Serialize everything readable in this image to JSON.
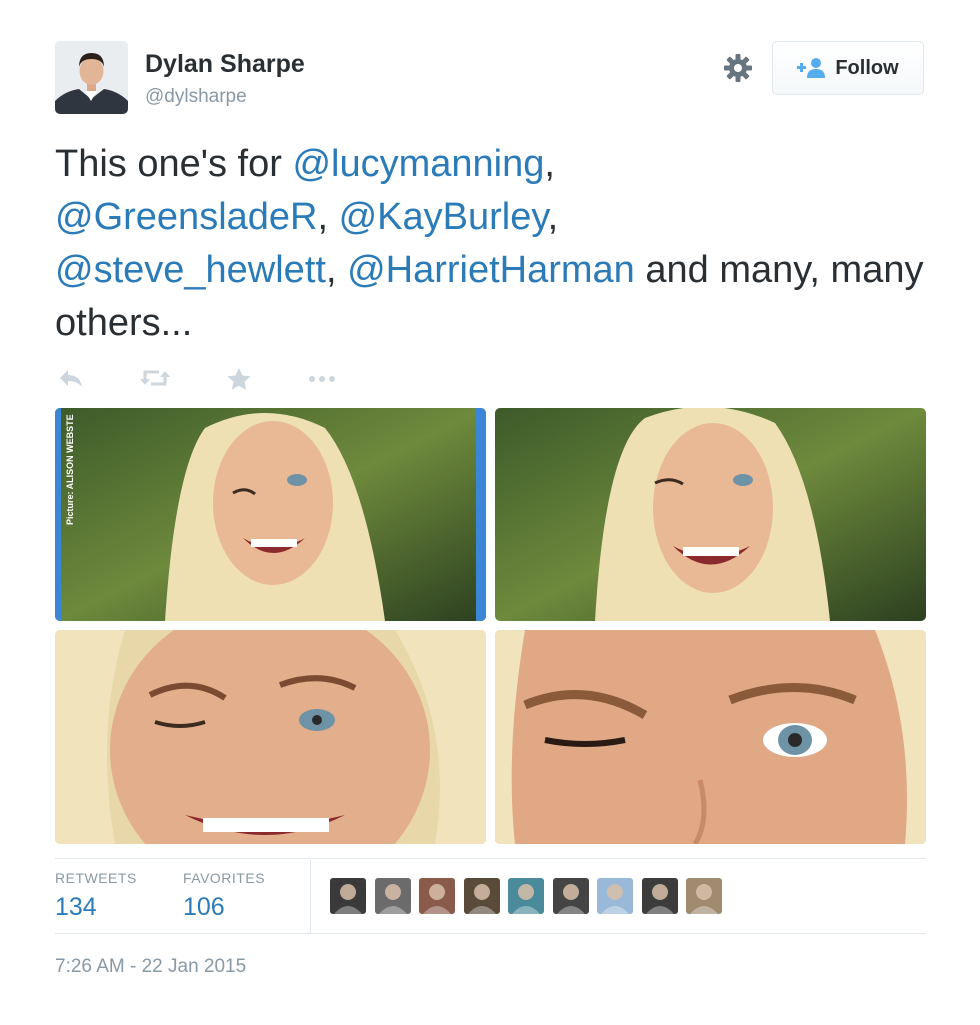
{
  "user": {
    "name": "Dylan Sharpe",
    "handle": "@dylsharpe"
  },
  "follow_button": {
    "label": "Follow",
    "icon": "add-user-icon"
  },
  "settings_icon": "gear-icon",
  "tweet": {
    "text_parts": [
      {
        "text": "This one's for ",
        "type": "text"
      },
      {
        "text": "@lucymanning",
        "type": "mention"
      },
      {
        "text": ", ",
        "type": "text"
      },
      {
        "text": "@GreensladeR",
        "type": "mention"
      },
      {
        "text": ", ",
        "type": "text"
      },
      {
        "text": "@KayBurley",
        "type": "mention"
      },
      {
        "text": ", ",
        "type": "text"
      },
      {
        "text": "@steve_hewlett",
        "type": "mention"
      },
      {
        "text": ", ",
        "type": "text"
      },
      {
        "text": "@HarrietHarman",
        "type": "mention"
      },
      {
        "text": " and many, many others...",
        "type": "text"
      }
    ]
  },
  "actions": [
    "reply-icon",
    "retweet-icon",
    "favorite-icon",
    "more-icon"
  ],
  "media": {
    "photos": [
      {
        "name": "photo-1",
        "caption": "Picture: ALISON WEBSTE"
      },
      {
        "name": "photo-2"
      },
      {
        "name": "photo-3"
      },
      {
        "name": "photo-4"
      }
    ]
  },
  "stats": {
    "retweets_label": "RETWEETS",
    "retweets_value": "134",
    "favorites_label": "FAVORITES",
    "favorites_value": "106",
    "favoriters_count": 9
  },
  "timestamp": "7:26 AM - 22 Jan 2015",
  "colors": {
    "link": "#2b7bb9",
    "text": "#292f33",
    "muted": "#8899a6",
    "border": "#e1e8ed"
  }
}
